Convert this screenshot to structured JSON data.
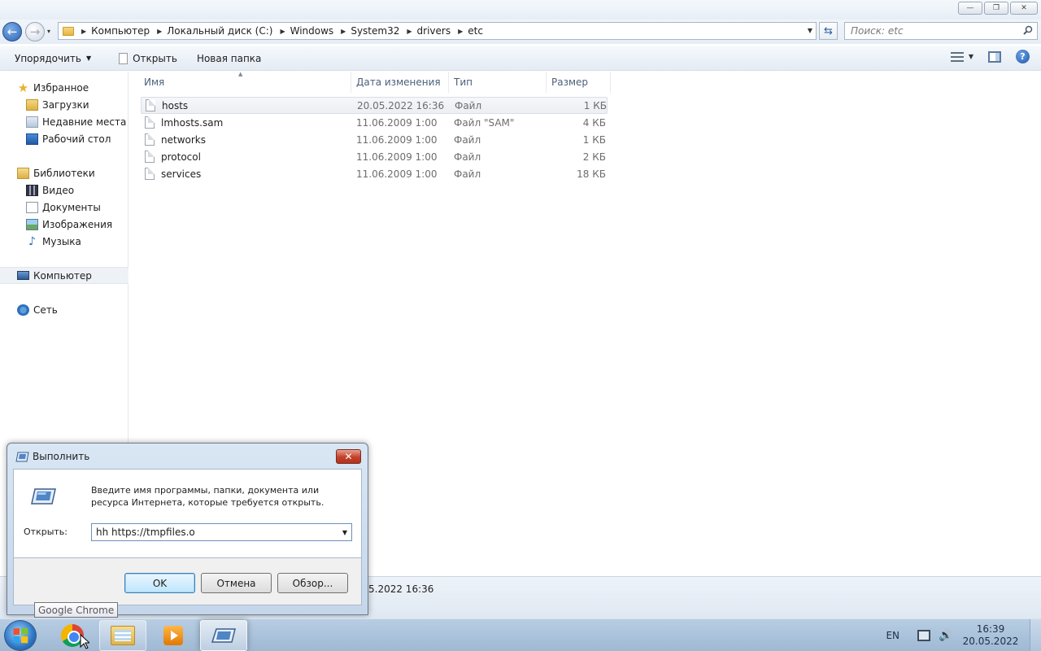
{
  "explorer": {
    "window_controls": {
      "minimize": "—",
      "maximize": "❐",
      "close": "✕"
    },
    "nav": {
      "back_icon": "←",
      "forward_icon": "→",
      "history_dropdown": "▾"
    },
    "breadcrumbs": [
      "Компьютер",
      "Локальный диск (C:)",
      "Windows",
      "System32",
      "drivers",
      "etc"
    ],
    "search": {
      "placeholder": "Поиск: etc"
    },
    "toolbar": {
      "organize_label": "Упорядочить",
      "open_label": "Открыть",
      "new_folder_label": "Новая папка"
    },
    "nav_pane": {
      "favorites": {
        "label": "Избранное",
        "items": [
          "Загрузки",
          "Недавние места",
          "Рабочий стол"
        ]
      },
      "libraries": {
        "label": "Библиотеки",
        "items": [
          "Видео",
          "Документы",
          "Изображения",
          "Музыка"
        ]
      },
      "computer": "Компьютер",
      "network": "Сеть"
    },
    "columns": {
      "name": "Имя",
      "date": "Дата изменения",
      "type": "Тип",
      "size": "Размер"
    },
    "files": [
      {
        "name": "hosts",
        "date": "20.05.2022 16:36",
        "type": "Файл",
        "size": "1 КБ"
      },
      {
        "name": "lmhosts.sam",
        "date": "11.06.2009 1:00",
        "type": "Файл \"SAM\"",
        "size": "4 КБ"
      },
      {
        "name": "networks",
        "date": "11.06.2009 1:00",
        "type": "Файл",
        "size": "1 КБ"
      },
      {
        "name": "protocol",
        "date": "11.06.2009 1:00",
        "type": "Файл",
        "size": "2 КБ"
      },
      {
        "name": "services",
        "date": "11.06.2009 1:00",
        "type": "Файл",
        "size": "18 КБ"
      }
    ],
    "details_partial_date": "5.2022 16:36"
  },
  "run_dialog": {
    "title": "Выполнить",
    "description": "Введите имя программы, папки, документа или ресурса Интернета, которые требуется открыть.",
    "open_label": "Открыть:",
    "command_value": "hh https://tmpfiles.o",
    "ok_label": "OK",
    "cancel_label": "Отмена",
    "browse_label": "Обзор..."
  },
  "tooltip": "Google Chrome",
  "taskbar": {
    "apps": [
      "chrome-icon",
      "windows-explorer-icon",
      "media-player-icon",
      "run-dialog-icon"
    ],
    "language": "EN",
    "time": "16:39",
    "date": "20.05.2022"
  }
}
